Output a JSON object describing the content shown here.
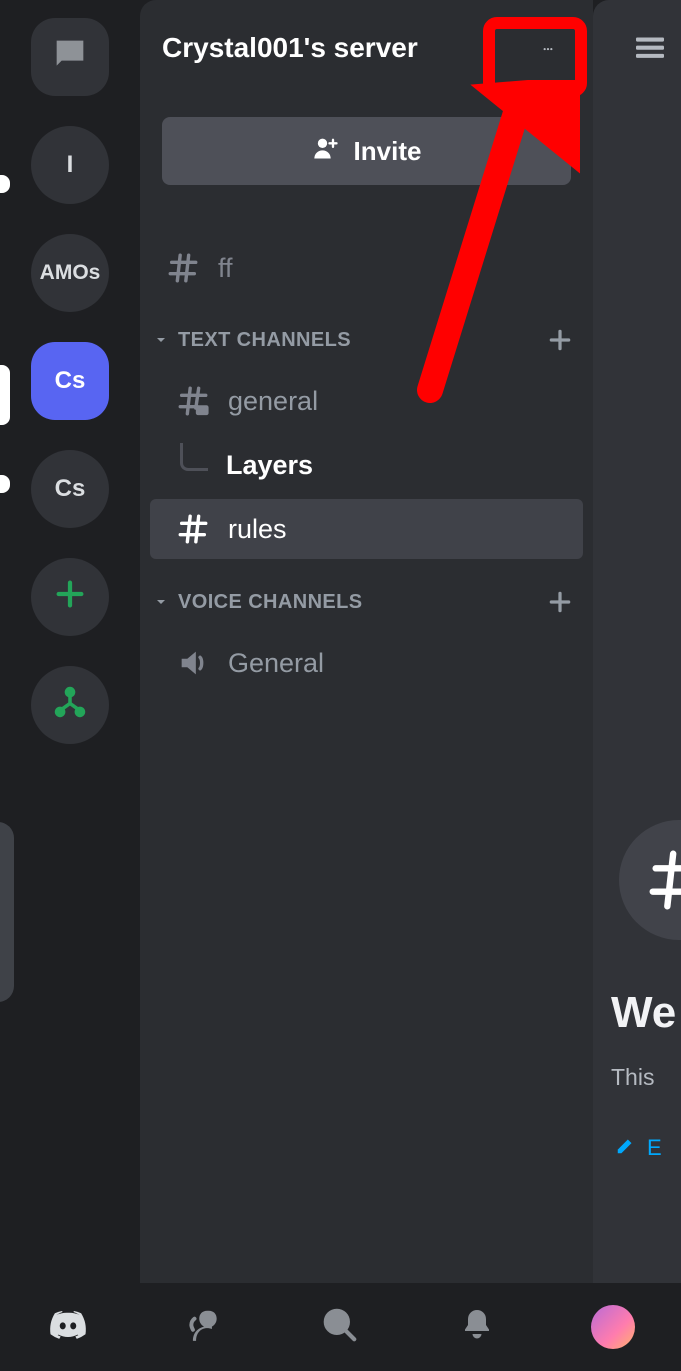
{
  "server_rail": {
    "items": [
      {
        "label": ""
      },
      {
        "label": "I"
      },
      {
        "label": "AMOs"
      },
      {
        "label": "Cs"
      },
      {
        "label": "Cs"
      }
    ]
  },
  "header": {
    "title": "Crystal001's server"
  },
  "invite": {
    "label": "Invite"
  },
  "orphan_channel": {
    "name": "ff"
  },
  "categories": [
    {
      "name": "TEXT CHANNELS",
      "channels": [
        {
          "name": "general",
          "threads": [
            {
              "name": "Layers"
            }
          ]
        },
        {
          "name": "rules",
          "selected": true
        }
      ]
    },
    {
      "name": "VOICE CHANNELS",
      "channels": [
        {
          "name": "General"
        }
      ]
    }
  ],
  "peek": {
    "welcome": "We",
    "sub": "This",
    "edit": "E"
  }
}
